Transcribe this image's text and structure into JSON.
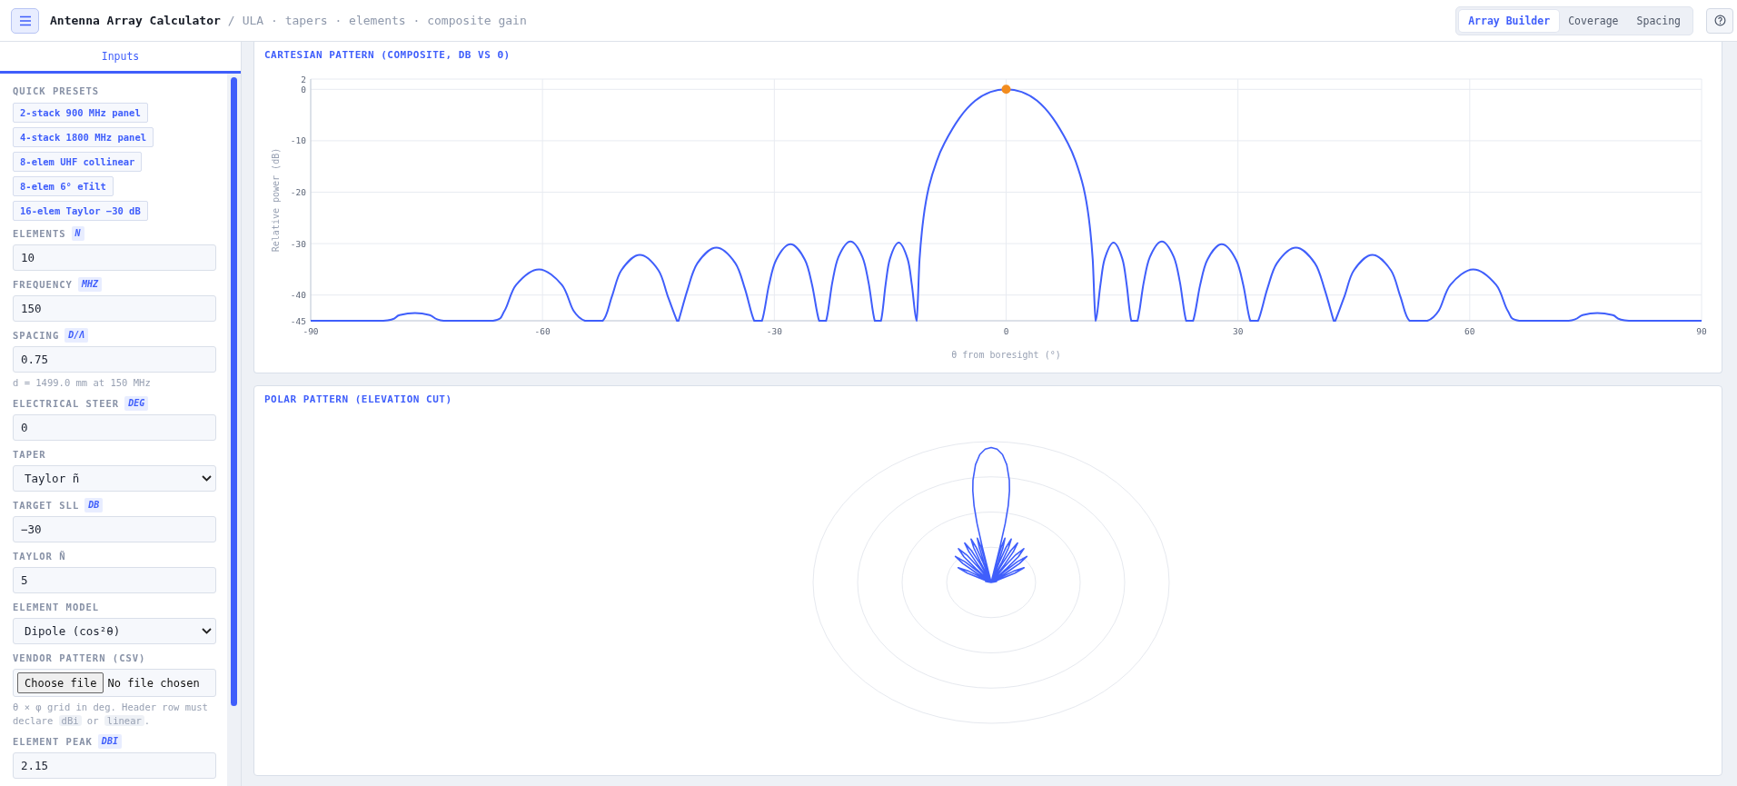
{
  "header": {
    "title": "Antenna Array Calculator",
    "separator": "/",
    "subtitle": "ULA · tapers · elements · composite gain",
    "views": [
      {
        "label": "Array Builder",
        "selected": true
      },
      {
        "label": "Coverage",
        "selected": false
      },
      {
        "label": "Spacing",
        "selected": false
      }
    ]
  },
  "sidebar": {
    "tabs": [
      {
        "label": "Inputs",
        "selected": true
      }
    ],
    "presets_label": "QUICK PRESETS",
    "presets": [
      "2-stack 900 MHz panel",
      "4-stack 1800 MHz panel",
      "8-elem UHF collinear",
      "8-elem 6° eTilt",
      "16-elem Taylor −30 dB"
    ],
    "fields": [
      {
        "kind": "input",
        "label": "ELEMENTS",
        "unit": "N",
        "value": "10"
      },
      {
        "kind": "input",
        "label": "FREQUENCY",
        "unit": "MHZ",
        "value": "150"
      },
      {
        "kind": "input",
        "label": "SPACING",
        "unit": "D/Λ",
        "value": "0.75",
        "hint": [
          {
            "kind": "text",
            "text": "d = 1499.0 mm at 150 MHz"
          }
        ]
      },
      {
        "kind": "input",
        "label": "ELECTRICAL STEER",
        "unit": "DEG",
        "value": "0"
      },
      {
        "kind": "select",
        "label": "TAPER",
        "value": "Taylor ñ"
      },
      {
        "kind": "input",
        "label": "TARGET SLL",
        "unit": "DB",
        "value": "−30"
      },
      {
        "kind": "input",
        "label": "TAYLOR Ñ",
        "value": "5"
      },
      {
        "kind": "select",
        "label": "ELEMENT MODEL",
        "value": "Dipole (cos²θ)"
      },
      {
        "kind": "file",
        "label": "VENDOR PATTERN (CSV)",
        "button": "Choose file",
        "status": "No file chosen",
        "hint": [
          {
            "kind": "text",
            "text": "θ × φ grid in deg. Header row must declare "
          },
          {
            "kind": "code",
            "text": "dBi"
          },
          {
            "kind": "text",
            "text": " or "
          },
          {
            "kind": "code",
            "text": "linear"
          },
          {
            "kind": "text",
            "text": "."
          }
        ]
      },
      {
        "kind": "input",
        "label": "ELEMENT PEAK",
        "unit": "DBI",
        "value": "2.15"
      }
    ]
  },
  "cartesian": {
    "title": "CARTESIAN PATTERN (COMPOSITE, DB VS Θ)",
    "chart_data": {
      "type": "line",
      "xlabel": "θ from boresight (°)",
      "ylabel": "Relative power (dB)",
      "xlim": [
        -90,
        90
      ],
      "ylim": [
        -45,
        2
      ],
      "xticks": [
        -90,
        -60,
        -30,
        0,
        30,
        60,
        90
      ],
      "yticks": [
        -45,
        -40,
        -30,
        -20,
        -10,
        0,
        2
      ],
      "x": [
        -90,
        -80.6,
        -78.5,
        -76.5,
        -74.6,
        -72.8,
        -66.4,
        -64.9,
        -63.4,
        -60.45,
        -57.5,
        -56,
        -54.5,
        -52.2,
        -51,
        -49.8,
        -47.4,
        -45,
        -43.8,
        -42.6,
        -42.4,
        -41.2,
        -39.95,
        -37.5,
        -35.05,
        -33.8,
        -32.6,
        -31.6,
        -30.7,
        -29.75,
        -27.9,
        -26.05,
        -25.1,
        -24.2,
        -23.3,
        -22.5,
        -21.7,
        -20.15,
        -18.6,
        -17.8,
        -17,
        -16.2,
        -15.6,
        -15.05,
        -13.9,
        -12.75,
        -12.2,
        -11.6,
        -11.2,
        -10.7,
        -10,
        -9,
        -8,
        -6,
        -4,
        -2,
        0,
        2,
        4,
        6,
        8,
        9,
        10,
        10.7,
        11.2,
        11.6,
        12.2,
        12.75,
        13.9,
        15.05,
        15.6,
        16.2,
        17,
        17.8,
        18.6,
        20.15,
        21.7,
        22.5,
        23.3,
        24.2,
        25.1,
        26.05,
        27.9,
        29.75,
        30.7,
        31.6,
        32.6,
        33.8,
        35.05,
        37.5,
        39.95,
        41.2,
        42.4,
        42.6,
        43.8,
        45,
        47.4,
        49.8,
        51,
        52.2,
        54.5,
        56,
        57.5,
        60.45,
        63.4,
        64.9,
        66.4,
        72.8,
        74.6,
        76.5,
        78.5,
        80.6,
        90
      ],
      "grid": true,
      "series": [
        {
          "color": "#3f5efb",
          "values": [
            -45,
            -45,
            -43.9,
            -43.5,
            -43.9,
            -45,
            -45,
            -43,
            -38,
            -35,
            -38,
            -43,
            -45,
            -45,
            -40.2,
            -35.2,
            -32.2,
            -35.2,
            -40.2,
            -45,
            -45,
            -38.8,
            -33.8,
            -30.8,
            -33.8,
            -38.8,
            -45,
            -45,
            -38.1,
            -33.1,
            -30.1,
            -33.1,
            -38.1,
            -45,
            -45,
            -37.6,
            -32.6,
            -29.6,
            -32.6,
            -37.6,
            -45,
            -45,
            -38,
            -33,
            -29.8,
            -33,
            -38,
            -45,
            -33,
            -25,
            -19,
            -14,
            -10.5,
            -5.5,
            -2.2,
            -0.5,
            0,
            -0.5,
            -2.2,
            -5.5,
            -10.5,
            -14,
            -19,
            -25,
            -33,
            -45,
            -38,
            -33,
            -29.8,
            -33,
            -38,
            -45,
            -45,
            -37.6,
            -32.6,
            -29.6,
            -32.6,
            -37.6,
            -45,
            -45,
            -38.1,
            -33.1,
            -30.1,
            -33.1,
            -38.1,
            -45,
            -45,
            -38.8,
            -33.8,
            -30.8,
            -33.8,
            -38.8,
            -45,
            -45,
            -40.2,
            -35.2,
            -32.2,
            -35.2,
            -40.2,
            -45,
            -45,
            -43,
            -38,
            -35,
            -38,
            -43,
            -45,
            -45,
            -43.9,
            -43.5,
            -43.9,
            -45,
            -45
          ]
        }
      ]
    },
    "peak_marker": {
      "color": "#f28c1e"
    }
  },
  "polar": {
    "title": "POLAR PATTERN (ELEVATION CUT)"
  }
}
